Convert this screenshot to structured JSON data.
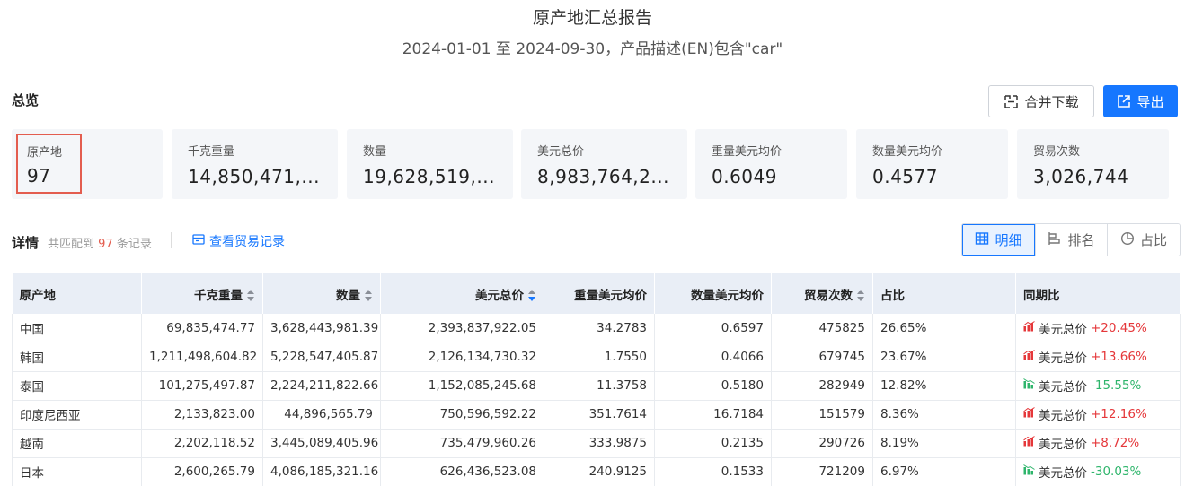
{
  "report": {
    "title": "原产地汇总报告",
    "subtitle": "2024-01-01 至 2024-09-30，产品描述(EN)包含\"car\""
  },
  "overview": {
    "label": "总览",
    "merge_download_label": "合并下载",
    "export_label": "导出",
    "cards": [
      {
        "label": "原产地",
        "value": "97"
      },
      {
        "label": "千克重量",
        "value": "14,850,471,..."
      },
      {
        "label": "数量",
        "value": "19,628,519,..."
      },
      {
        "label": "美元总价",
        "value": "8,983,764,2..."
      },
      {
        "label": "重量美元均价",
        "value": "0.6049"
      },
      {
        "label": "数量美元均价",
        "value": "0.4577"
      },
      {
        "label": "贸易次数",
        "value": "3,026,744"
      }
    ]
  },
  "details": {
    "label": "详情",
    "match_prefix": "共匹配到",
    "match_count": "97",
    "match_suffix": "条记录",
    "view_records_label": "查看贸易记录",
    "views": [
      "明细",
      "排名",
      "占比"
    ]
  },
  "table": {
    "headers": [
      "原产地",
      "千克重量",
      "数量",
      "美元总价",
      "重量美元均价",
      "数量美元均价",
      "贸易次数",
      "占比",
      "同期比"
    ],
    "rows": [
      {
        "origin": "中国",
        "kg": "69,835,474.77",
        "qty": "3,628,443,981.39",
        "usd": "2,393,837,922.05",
        "kg_avg": "34.2783",
        "qty_avg": "0.6597",
        "trades": "475825",
        "share": "26.65%",
        "yoy_label": "美元总价",
        "yoy_value": "+20.45%",
        "yoy_dir": "up"
      },
      {
        "origin": "韩国",
        "kg": "1,211,498,604.82",
        "qty": "5,228,547,405.87",
        "usd": "2,126,134,730.32",
        "kg_avg": "1.7550",
        "qty_avg": "0.4066",
        "trades": "679745",
        "share": "23.67%",
        "yoy_label": "美元总价",
        "yoy_value": "+13.66%",
        "yoy_dir": "up"
      },
      {
        "origin": "泰国",
        "kg": "101,275,497.87",
        "qty": "2,224,211,822.66",
        "usd": "1,152,085,245.68",
        "kg_avg": "11.3758",
        "qty_avg": "0.5180",
        "trades": "282949",
        "share": "12.82%",
        "yoy_label": "美元总价",
        "yoy_value": "-15.55%",
        "yoy_dir": "down"
      },
      {
        "origin": "印度尼西亚",
        "kg": "2,133,823.00",
        "qty": "44,896,565.79",
        "usd": "750,596,592.22",
        "kg_avg": "351.7614",
        "qty_avg": "16.7184",
        "trades": "151579",
        "share": "8.36%",
        "yoy_label": "美元总价",
        "yoy_value": "+12.16%",
        "yoy_dir": "up"
      },
      {
        "origin": "越南",
        "kg": "2,202,118.52",
        "qty": "3,445,089,405.96",
        "usd": "735,479,960.26",
        "kg_avg": "333.9875",
        "qty_avg": "0.2135",
        "trades": "290726",
        "share": "8.19%",
        "yoy_label": "美元总价",
        "yoy_value": "+8.72%",
        "yoy_dir": "up"
      },
      {
        "origin": "日本",
        "kg": "2,600,265.79",
        "qty": "4,086,185,321.16",
        "usd": "626,436,523.08",
        "kg_avg": "240.9125",
        "qty_avg": "0.1533",
        "trades": "721209",
        "share": "6.97%",
        "yoy_label": "美元总价",
        "yoy_value": "-30.03%",
        "yoy_dir": "down"
      }
    ]
  },
  "colors": {
    "accent": "#1677ff",
    "highlight_border": "#e35d4f",
    "up": "#e5373a",
    "down": "#2eb56b",
    "card_bg": "#f4f6f9",
    "header_bg": "#e9eef6"
  }
}
